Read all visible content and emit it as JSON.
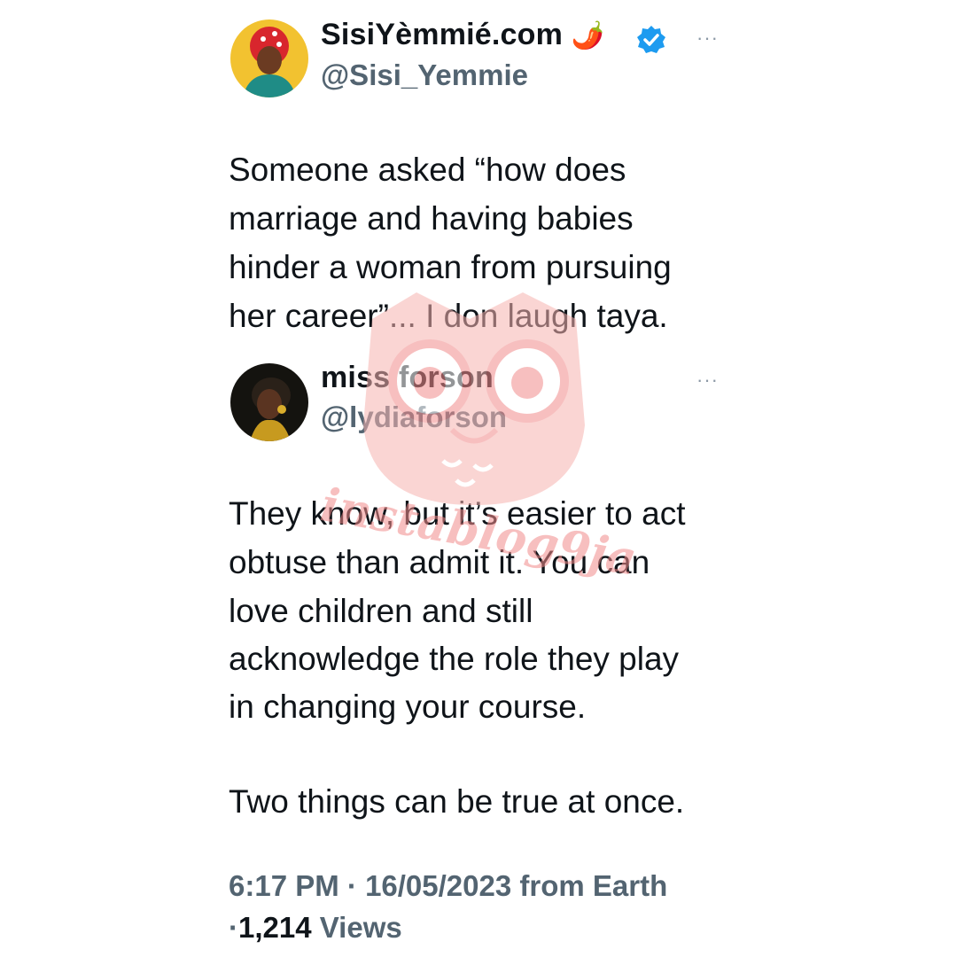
{
  "tweet": {
    "author_name": "SisiYèmmié.com",
    "name_emoji": "🌶️",
    "verified_icon": "verified-badge-icon",
    "handle": "@Sisi_Yemmie",
    "more_label": "···",
    "text_lines": [
      "Someone asked “how does",
      "marriage and having babies",
      "hinder a woman from pursuing",
      "her career”... I don laugh taya."
    ]
  },
  "quoted_tweet": {
    "author_name": "miss forson",
    "handle": "@lydiaforson",
    "more_label": "···",
    "text_lines": [
      "They know, but it’s easier to act",
      "obtuse than admit it. You can",
      "love children and still",
      "acknowledge the role they play",
      "in changing your course.",
      "",
      "Two things can be true at once."
    ]
  },
  "meta": {
    "time": "6:17 PM",
    "separator": "·",
    "date": "16/05/2023",
    "source": "from Earth",
    "views_count": "1,214",
    "views_label": "Views"
  },
  "watermark": {
    "text": "instablog9ja",
    "color": "#f28b8b"
  },
  "colors": {
    "verified": "#1d9bf0",
    "secondary_text": "#536471",
    "primary_text": "#0f1419"
  }
}
